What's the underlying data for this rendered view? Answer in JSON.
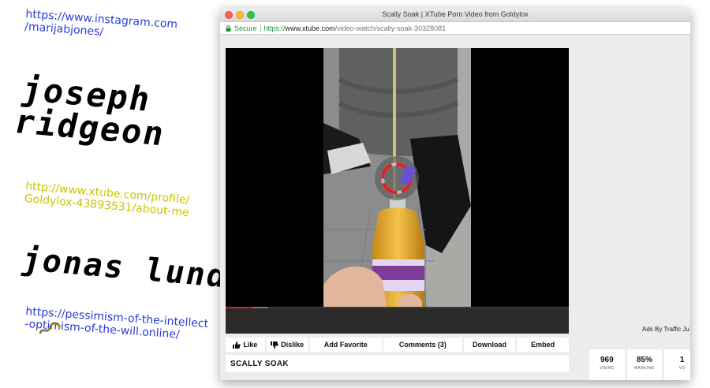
{
  "poster": {
    "instagram_link": "https://www.instagram.com\n/marijabjones/",
    "name_one_line1": "joseph",
    "name_one_line2": "ridgeon",
    "xtube_link": "http://www.xtube.com/profile/\nGoldylox-43893531/about-me",
    "name_two": "jonas lund",
    "pessimism_link": "https://pessimism-of-the-intellect\n-optimism-of-the-will.online/"
  },
  "browser": {
    "window_title": "Scally Soak | XTube Porn Video from Goldylox",
    "secure_label": "Secure",
    "url_scheme": "https://",
    "url_host": "www.xtube.com",
    "url_path": "/video-watch/scally-soak-30328081"
  },
  "page": {
    "ads_label": "Ads By Traffic Ju",
    "actions": {
      "like": "Like",
      "dislike": "Dislike",
      "add_favorite": "Add Favorite",
      "comments": "Comments (3)",
      "download": "Download",
      "embed": "Embed"
    },
    "video_title": "SCALLY SOAK",
    "progress_played_fraction": 0.08,
    "stats": [
      {
        "value": "969",
        "label": "VIEWS"
      },
      {
        "value": "85%",
        "label": "RANKING"
      },
      {
        "value": "1",
        "label": "VO"
      }
    ]
  },
  "colors": {
    "link_blue": "#2a3bd6",
    "link_yellow": "#c8c500",
    "secure_green": "#1e8e3e",
    "progress_red": "#d21f1f"
  }
}
